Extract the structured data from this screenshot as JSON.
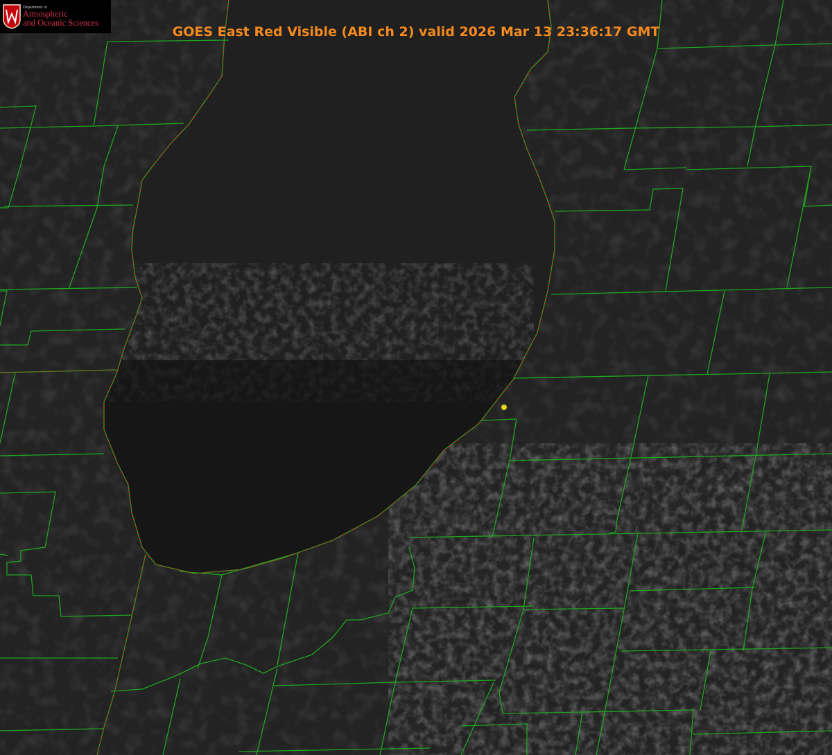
{
  "title": "GOES East Red Visible (ABI ch 2) valid 2026 Mar 13 23:36:17 GMT",
  "logo": {
    "department": "Department of",
    "line1": "Atmospheric",
    "line2": "and Oceanic Sciences",
    "crest_letter": "W"
  },
  "map": {
    "product": "visible satellite imagery",
    "background_color": "#232323",
    "lake_color": "#161616",
    "boundary_color": "#1fa51f",
    "shoreline_color": "#d8261e",
    "station_marker_color": "#e8d21a"
  }
}
